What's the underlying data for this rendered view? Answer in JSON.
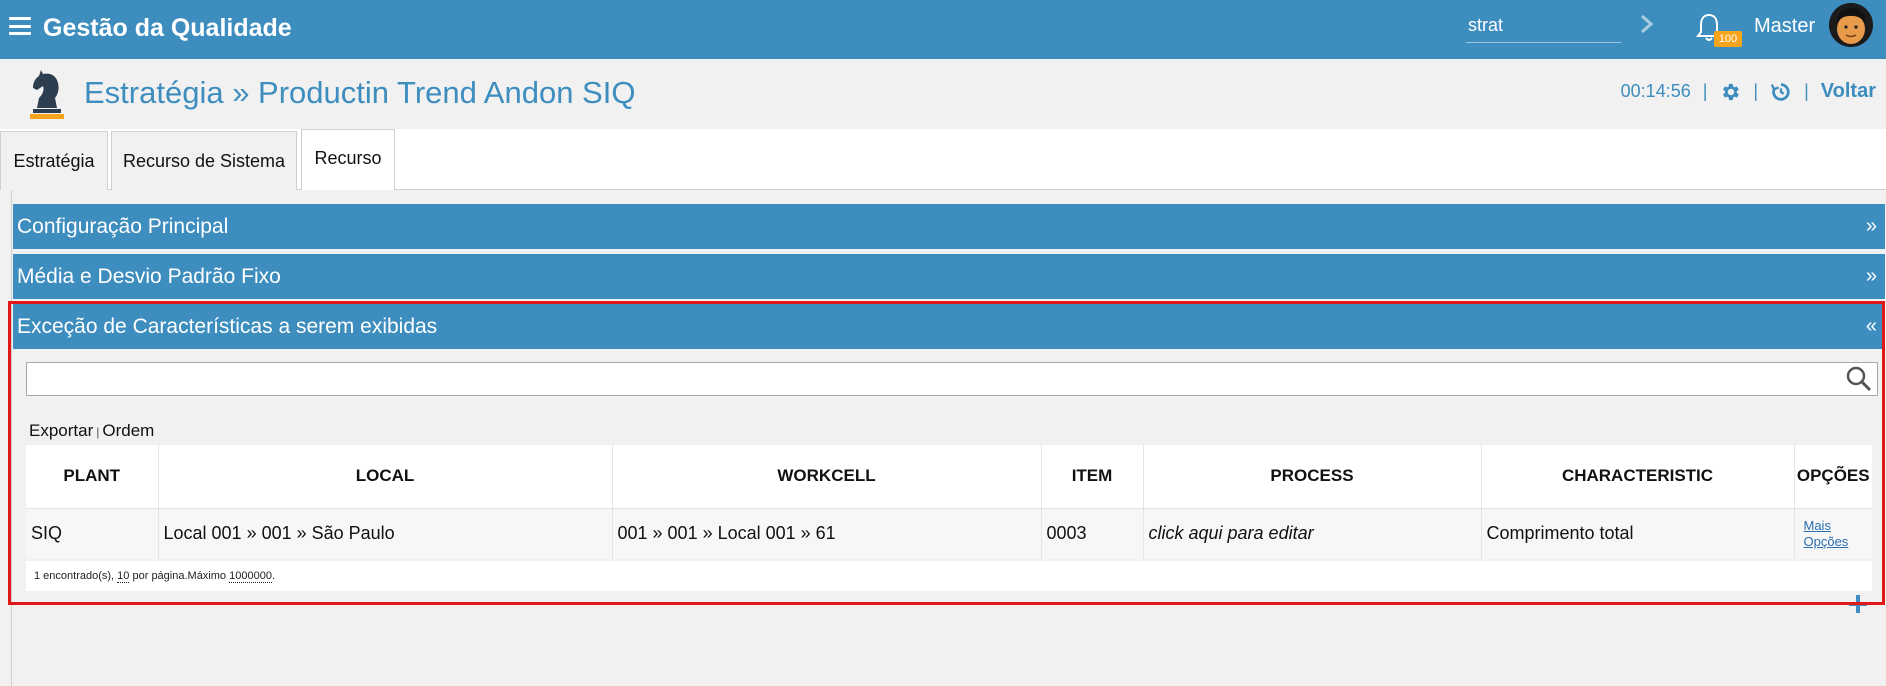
{
  "topbar": {
    "menu_icon": "hamburger-menu-icon",
    "title": "Gestão da Qualidade",
    "search_value": "strat",
    "go_icon": "chevron-right-icon",
    "notif_icon": "bell-icon",
    "notif_count": "100",
    "username": "Master",
    "accent": "#3d8dbf",
    "badge_color": "#f5a41c"
  },
  "header": {
    "module_icon": "chess-knight-icon",
    "title": "Estratégia » Productin Trend Andon SIQ",
    "timer": "00:14:56",
    "settings_icon": "gear-icon",
    "history_icon": "history-icon",
    "back_label": "Voltar"
  },
  "tabs": [
    {
      "label": "Estratégia"
    },
    {
      "label": "Recurso de Sistema"
    },
    {
      "label": "Recurso"
    }
  ],
  "panels": [
    {
      "title": "Configuração Principal",
      "toggle": "»"
    },
    {
      "title": "Média e Desvio Padrão Fixo",
      "toggle": "»"
    },
    {
      "title": "Exceção de Características a serem exibidas",
      "toggle": "«"
    }
  ],
  "table_section": {
    "filter_value": "",
    "search_icon": "magnifier-icon",
    "export_label": "Exportar",
    "order_label": "Ordem",
    "separator": "|",
    "columns": [
      "PLANT",
      "LOCAL",
      "WORKCELL",
      "ITEM",
      "PROCESS",
      "CHARACTERISTIC",
      "OPÇÕES"
    ],
    "rows": [
      {
        "plant": "SIQ",
        "local": "Local 001 » 001 » São Paulo",
        "workcell": "001 » 001 » Local 001 » 61",
        "item": "0003",
        "process": "click aqui para editar",
        "characteristic": "Comprimento total",
        "options_line1": "Mais",
        "options_line2": "Opções"
      }
    ],
    "footer": {
      "found_text": "1 encontrado(s),",
      "per_page": "10",
      "per_page_text": "por página.Máximo",
      "max": "1000000",
      "end": "."
    },
    "add_icon": "plus-icon"
  }
}
